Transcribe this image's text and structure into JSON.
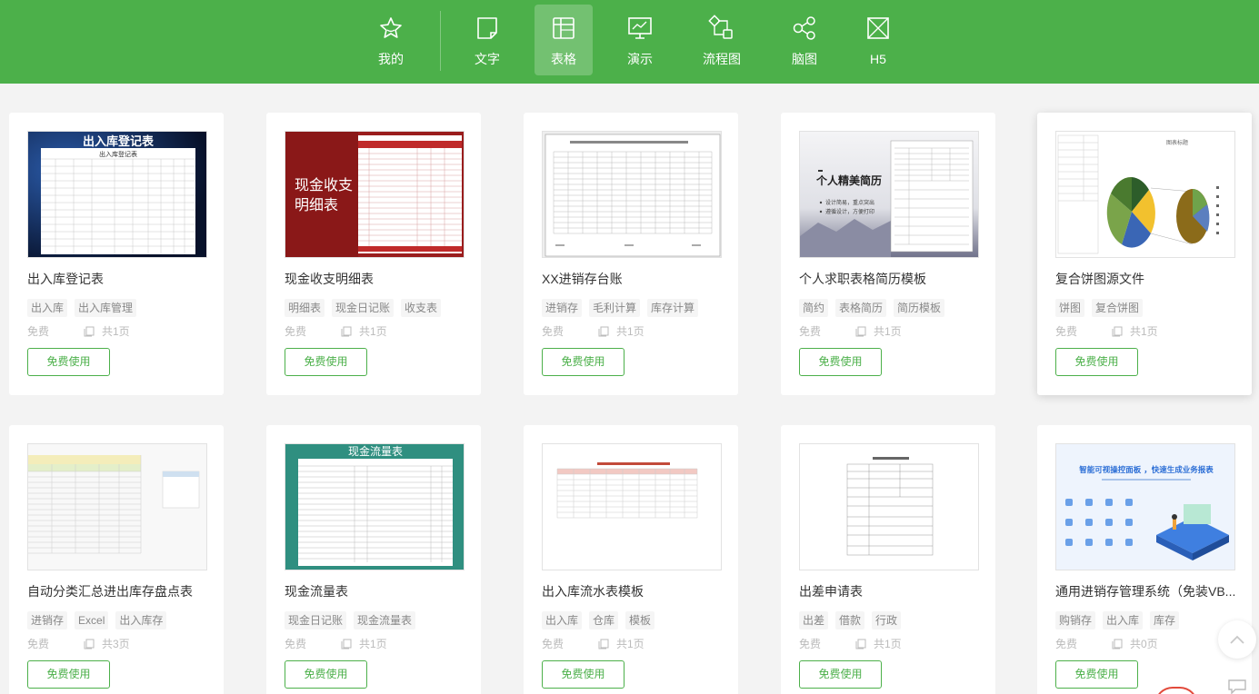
{
  "nav": {
    "items": [
      {
        "label": "我的",
        "icon": "star-icon"
      },
      {
        "label": "文字",
        "icon": "document-icon"
      },
      {
        "label": "表格",
        "icon": "table-icon",
        "active": true
      },
      {
        "label": "演示",
        "icon": "presentation-icon"
      },
      {
        "label": "流程图",
        "icon": "flowchart-icon"
      },
      {
        "label": "脑图",
        "icon": "mindmap-icon"
      },
      {
        "label": "H5",
        "icon": "h5-icon"
      }
    ]
  },
  "cards": [
    {
      "title": "出入库登记表",
      "tags": [
        "出入库",
        "出入库管理"
      ],
      "price": "免费",
      "pages": "共1页",
      "button": "免费使用",
      "thumb": {
        "style": "dark-blue",
        "heading": "出入库登记表",
        "sub": "出入库登记表"
      }
    },
    {
      "title": "现金收支明细表",
      "tags": [
        "明细表",
        "现金日记账",
        "收支表"
      ],
      "price": "免费",
      "pages": "共1页",
      "button": "免费使用",
      "thumb": {
        "style": "red-sheet",
        "heading": "现金收支",
        "heading2": "明细表"
      }
    },
    {
      "title": "XX进销存台账",
      "tags": [
        "进销存",
        "毛利计算",
        "库存计算"
      ],
      "price": "免费",
      "pages": "共1页",
      "button": "免费使用",
      "thumb": {
        "style": "plain-sheet"
      }
    },
    {
      "title": "个人求职表格简历模板",
      "tags": [
        "简约",
        "表格简历",
        "简历模板"
      ],
      "price": "免费",
      "pages": "共1页",
      "button": "免费使用",
      "thumb": {
        "style": "resume",
        "heading": "个人精美简历",
        "bullet1": "设计简易，重点突出",
        "bullet2": "遵循设计，方便打印"
      }
    },
    {
      "title": "复合饼图源文件",
      "tags": [
        "饼图",
        "复合饼图"
      ],
      "price": "免费",
      "pages": "共1页",
      "button": "免费使用",
      "thumb": {
        "style": "pie-chart",
        "heading": "图表标题"
      },
      "hover": true
    },
    {
      "title": "自动分类汇总进出库存盘点表",
      "tags": [
        "进销存",
        "Excel",
        "出入库存"
      ],
      "price": "免费",
      "pages": "共3页",
      "button": "免费使用",
      "thumb": {
        "style": "yellow-sheet"
      }
    },
    {
      "title": "现金流量表",
      "tags": [
        "现金日记账",
        "现金流量表"
      ],
      "price": "免费",
      "pages": "共1页",
      "button": "免费使用",
      "thumb": {
        "style": "teal-sheet",
        "heading": "现金流量表"
      }
    },
    {
      "title": "出入库流水表模板",
      "tags": [
        "出入库",
        "仓库",
        "模板"
      ],
      "price": "免费",
      "pages": "共1页",
      "button": "免费使用",
      "thumb": {
        "style": "red-header-sheet"
      }
    },
    {
      "title": "出差申请表",
      "tags": [
        "出差",
        "借款",
        "行政"
      ],
      "price": "免费",
      "pages": "共1页",
      "button": "免费使用",
      "thumb": {
        "style": "form-sheet"
      }
    },
    {
      "title": "通用进销存管理系统（免装VB...",
      "tags": [
        "购销存",
        "出入库",
        "库存"
      ],
      "price": "免费",
      "pages": "共0页",
      "button": "免费使用",
      "thumb": {
        "style": "dashboard",
        "heading": "智能可视操控面板 ，快速生成业务报表"
      }
    }
  ],
  "scroll_top": {
    "icon": "chevron-up-icon"
  },
  "chat": {
    "icon": "chat-icon"
  }
}
